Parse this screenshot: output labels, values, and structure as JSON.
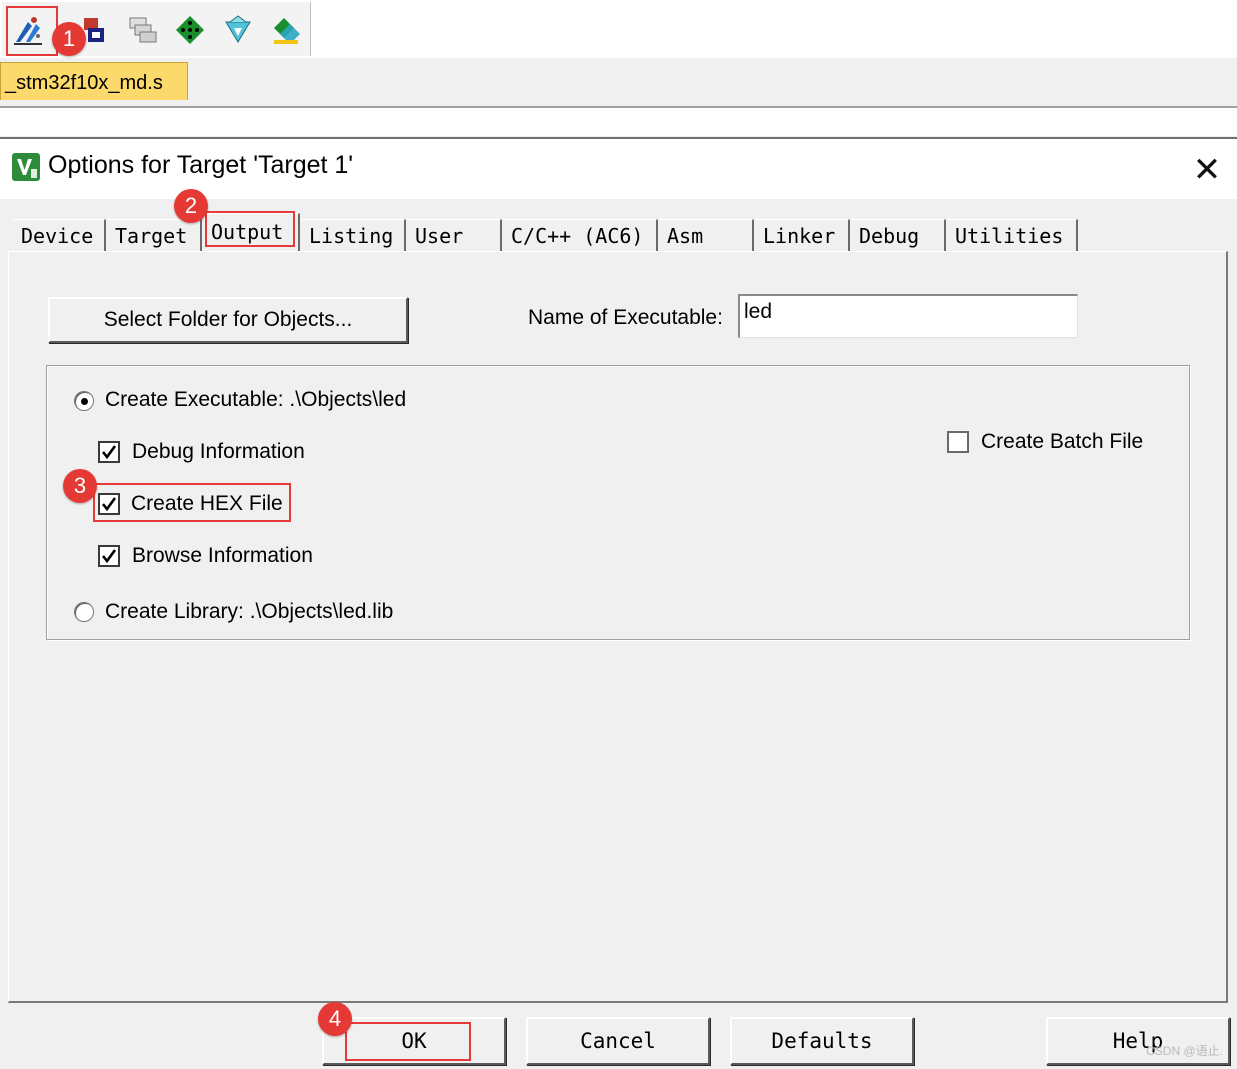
{
  "toolbar": {
    "icons": [
      "options-for-target-icon",
      "manage-components-icon",
      "select-packs-icon",
      "run-environment-icon",
      "pack-installer-icon",
      "batch-build-icon"
    ]
  },
  "file_tab": {
    "label": "_stm32f10x_md.s"
  },
  "dialog": {
    "title": "Options for Target 'Target 1'",
    "tabs": [
      "Device",
      "Target",
      "Output",
      "Listing",
      "User",
      "C/C++ (AC6)",
      "Asm",
      "Linker",
      "Debug",
      "Utilities"
    ],
    "active_tab": "Output",
    "select_folder_label": "Select Folder for Objects...",
    "exe_name_label": "Name of Executable:",
    "exe_name_value": "led",
    "create_executable_label": "Create Executable:  .\\Objects\\led",
    "debug_info_label": "Debug Information",
    "create_hex_label": "Create HEX File",
    "browse_info_label": "Browse Information",
    "create_library_label": "Create Library:  .\\Objects\\led.lib",
    "create_batch_label": "Create Batch File",
    "ok_label": "OK",
    "cancel_label": "Cancel",
    "defaults_label": "Defaults",
    "help_label": "Help"
  },
  "state": {
    "create_executable": true,
    "debug_information": true,
    "create_hex_file": true,
    "browse_information": true,
    "create_library": false,
    "create_batch_file": false
  },
  "annotations": {
    "m1": "1",
    "m2": "2",
    "m3": "3",
    "m4": "4"
  },
  "watermark": "CSDN @语止.",
  "colors": {
    "annotation_red": "#e53935",
    "file_tab_bg": "#fbd96a",
    "dialog_bg": "#f0f0f0"
  }
}
